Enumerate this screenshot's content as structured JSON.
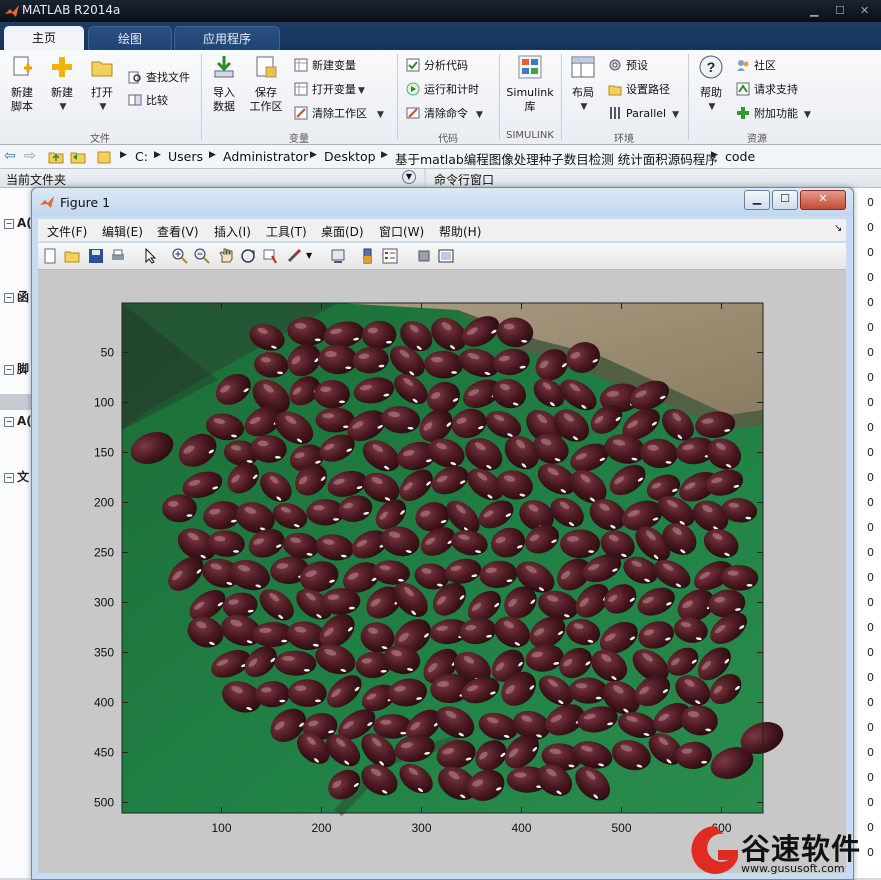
{
  "window": {
    "title": "MATLAB R2014a"
  },
  "tabs": [
    {
      "label": "主页"
    },
    {
      "label": "绘图"
    },
    {
      "label": "应用程序"
    }
  ],
  "ribbon": {
    "file_section": {
      "label": "文件",
      "new_script": "新建\n脚本",
      "new": "新建",
      "open": "打开",
      "find_files": "查找文件",
      "compare": "比较"
    },
    "variable_section": {
      "label": "变量",
      "import_data": "导入\n数据",
      "save_workspace": "保存\n工作区",
      "new_variable": "新建变量",
      "open_variable": "打开变量",
      "clear_workspace": "清除工作区"
    },
    "code_section": {
      "label": "代码",
      "analyze_code": "分析代码",
      "run_and_time": "运行和计时",
      "clear_commands": "清除命令"
    },
    "simulink_section": {
      "label": "SIMULINK",
      "simulink_library": "Simulink\n库"
    },
    "environment_section": {
      "label": "环境",
      "layout": "布局",
      "preferences": "预设",
      "set_path": "设置路径",
      "parallel": "Parallel"
    },
    "resources_section": {
      "label": "资源",
      "help": "帮助",
      "community": "社区",
      "request_support": "请求支持",
      "add_ons": "附加功能"
    }
  },
  "address_bar": {
    "path": [
      "C:",
      "Users",
      "Administrator",
      "Desktop",
      "基于matlab编程图像处理种子数目检测 统计面积源码程序",
      "code"
    ]
  },
  "panels": {
    "current_folder": "当前文件夹",
    "command_window": "命令行窗口",
    "left_items": [
      "A(",
      "函",
      "脚",
      "A(",
      "文"
    ],
    "cmd_zero": "0"
  },
  "figure": {
    "title": "Figure 1",
    "menus": [
      "文件(F)",
      "编辑(E)",
      "查看(V)",
      "插入(I)",
      "工具(T)",
      "桌面(D)",
      "窗口(W)",
      "帮助(H)"
    ],
    "axes": {
      "x_ticks": [
        "100",
        "200",
        "300",
        "400",
        "500",
        "600"
      ],
      "y_ticks": [
        "50",
        "100",
        "150",
        "200",
        "250",
        "300",
        "350",
        "400",
        "450",
        "500"
      ]
    }
  },
  "watermark": {
    "name": "谷速软件",
    "url": "www.gususoft.com"
  },
  "colors": {
    "ribbon_tab": "#1c3d66",
    "background_green": "#1f7a3c",
    "bean": "#4a1820",
    "accent_red": "#e02b20"
  }
}
